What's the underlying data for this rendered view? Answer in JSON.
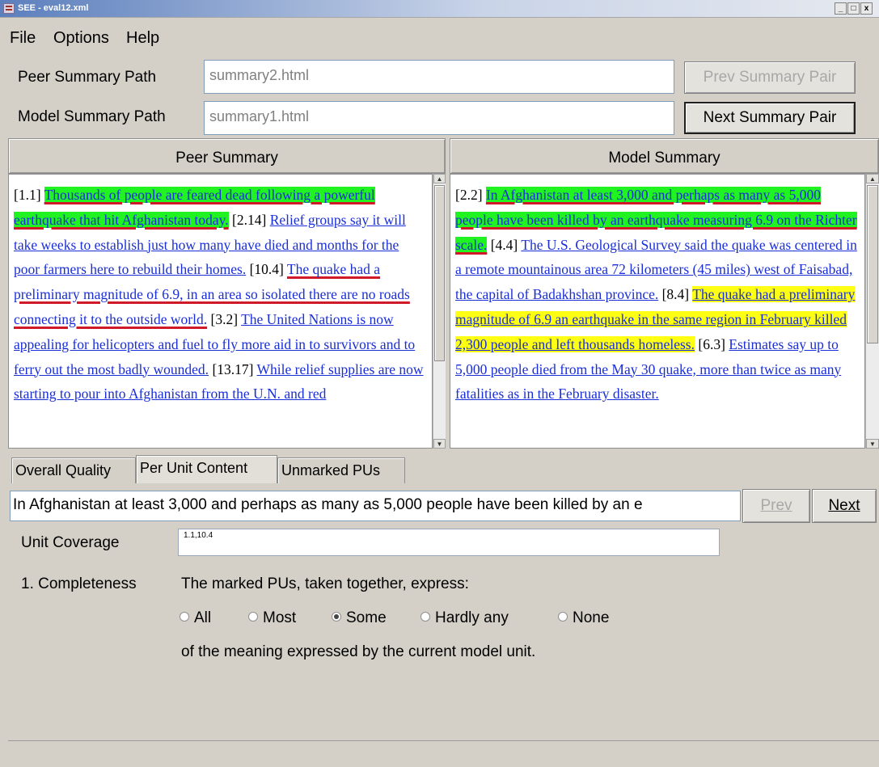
{
  "window": {
    "title": "SEE - eval12.xml",
    "controls": [
      "_",
      "□",
      "x"
    ]
  },
  "menubar": [
    "File",
    "Options",
    "Help"
  ],
  "paths": {
    "peer_label": "Peer Summary Path",
    "peer_value": "summary2.html",
    "model_label": "Model Summary Path",
    "model_value": "summary1.html",
    "prev_pair": "Prev Summary Pair",
    "next_pair": "Next Summary Pair"
  },
  "peer": {
    "header": "Peer Summary",
    "segments": [
      {
        "t": "[1.1] ",
        "c": "id"
      },
      {
        "t": "Thousands of people are feared dead following a powerful earthquake that hit Afghanistan today.",
        "c": "u hl-green red"
      },
      {
        "t": " [2.14] ",
        "c": "id"
      },
      {
        "t": "Relief groups say it will take weeks to establish just how many have died and months for the poor farmers here to rebuild their homes.",
        "c": "u"
      },
      {
        "t": " [10.4] ",
        "c": "id"
      },
      {
        "t": "The quake had a preliminary magnitude of 6.9, in an area so isolated there are no roads connecting it to the outside world.",
        "c": "u red"
      },
      {
        "t": " [3.2] ",
        "c": "id"
      },
      {
        "t": "The United Nations is now appealing for helicopters and fuel to fly more aid in to survivors and to ferry out the most badly wounded.",
        "c": "u"
      },
      {
        "t": " [13.17] ",
        "c": "id"
      },
      {
        "t": "While relief supplies are now starting to pour into Afghanistan from the U.N. and red",
        "c": "u"
      }
    ]
  },
  "model": {
    "header": "Model Summary",
    "segments": [
      {
        "t": "[2.2] ",
        "c": "id"
      },
      {
        "t": "In Afghanistan at least 3,000 and perhaps as many as 5,000 people have been killed by an earthquake measuring 6.9 on the Richter scale.",
        "c": "u hl-green red"
      },
      {
        "t": " [4.4] ",
        "c": "id"
      },
      {
        "t": "The U.S. Geological Survey said the quake was centered in a remote mountainous area 72 kilometers (45 miles) west of Faisabad, the capital of Badakhshan province.",
        "c": "u"
      },
      {
        "t": " [8.4] ",
        "c": "id"
      },
      {
        "t": "The quake had a preliminary magnitude of 6.9 an earthquake in the same region in February killed 2,300 people and left thousands homeless.",
        "c": "u hl-yellow"
      },
      {
        "t": " [6.3] ",
        "c": "id"
      },
      {
        "t": "Estimates say up to 5,000 people died from the May 30 quake, more than twice as many fatalities as in the February disaster.",
        "c": "u"
      }
    ]
  },
  "tabs": [
    "Overall Quality",
    "Per Unit Content",
    "Unmarked PUs"
  ],
  "selected_tab": "Per Unit Content",
  "unit_text": "In Afghanistan at least 3,000 and perhaps as many as 5,000 people have been killed by an e",
  "prev_label": "Prev",
  "next_label": "Next",
  "coverage": {
    "label": "Unit Coverage",
    "value": "1.1,10.4"
  },
  "completeness": {
    "label": "1. Completeness",
    "prompt": "The marked PUs, taken together, express:",
    "options": [
      "All",
      "Most",
      "Some",
      "Hardly any",
      "None"
    ],
    "selected": "Some",
    "suffix": "of the meaning expressed by the current model unit."
  },
  "status": ""
}
